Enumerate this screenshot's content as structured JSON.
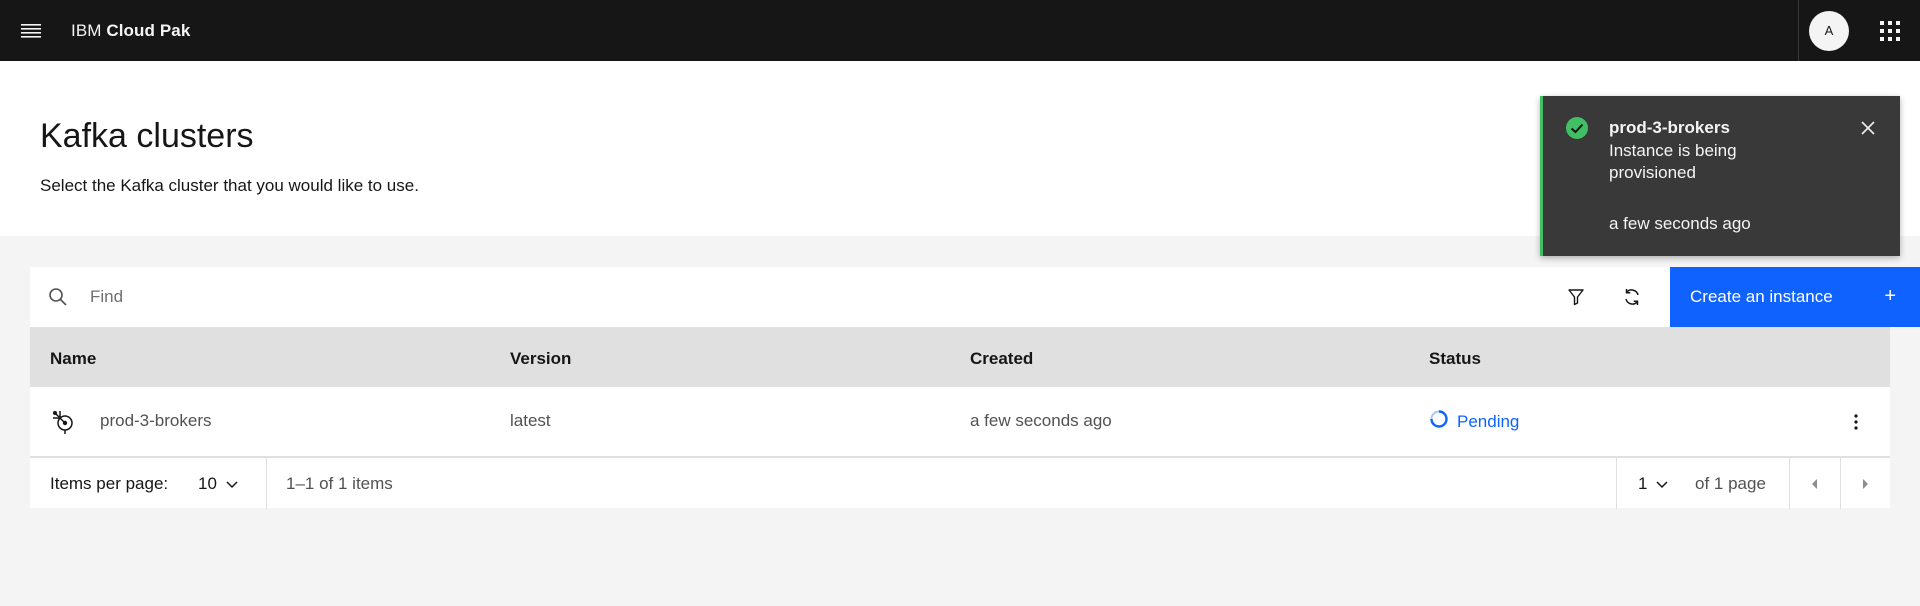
{
  "header": {
    "brand_prefix": "IBM",
    "brand_name": "Cloud Pak",
    "avatar_initial": "A",
    "menu_icon": "hamburger-menu-icon",
    "switcher_icon": "app-switcher-icon"
  },
  "page": {
    "title": "Kafka clusters",
    "subtitle": "Select the Kafka cluster that you would like to use."
  },
  "toolbar": {
    "search_placeholder": "Find",
    "create_label": "Create an instance",
    "create_icon": "+"
  },
  "table": {
    "headers": [
      "Name",
      "Version",
      "Created",
      "Status"
    ],
    "rows": [
      {
        "name": "prod-3-brokers",
        "version": "latest",
        "created": "a few seconds ago",
        "status": "Pending",
        "icon": "kafka-cluster-icon"
      }
    ]
  },
  "pagination": {
    "items_per_page_label": "Items per page:",
    "page_size": "10",
    "range_text": "1–1 of 1 items",
    "current_page": "1",
    "of_pages_text": "of 1 page"
  },
  "toast": {
    "title": "prod-3-brokers",
    "subtitle": "Instance is being provisioned",
    "time": "a few seconds ago"
  },
  "colors": {
    "header_bg": "#161616",
    "primary": "#0f62fe",
    "success": "#42be65",
    "toast_bg": "#393939"
  }
}
